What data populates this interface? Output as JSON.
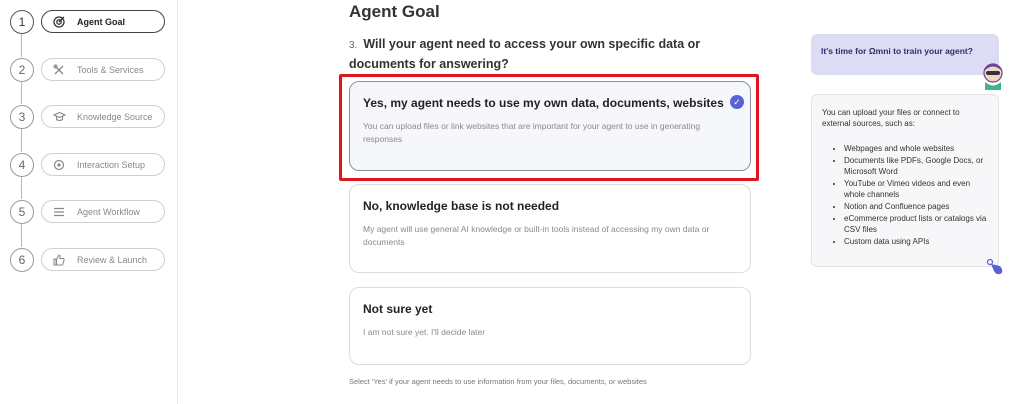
{
  "steps": [
    {
      "num": "1",
      "label": "Agent Goal",
      "icon": "target-icon",
      "active": true
    },
    {
      "num": "2",
      "label": "Tools & Services",
      "icon": "tools-icon",
      "active": false
    },
    {
      "num": "3",
      "label": "Knowledge Source",
      "icon": "graduation-cap-icon",
      "active": false
    },
    {
      "num": "4",
      "label": "Interaction Setup",
      "icon": "gear-icon",
      "active": false
    },
    {
      "num": "5",
      "label": "Agent Workflow",
      "icon": "list-icon",
      "active": false
    },
    {
      "num": "6",
      "label": "Review & Launch",
      "icon": "thumbs-up-icon",
      "active": false
    }
  ],
  "main": {
    "title": "Agent Goal",
    "question_number": "3.",
    "question": "Will your agent need to access your own specific data or documents for answering?",
    "options": [
      {
        "title": "Yes, my agent needs to use my own data, documents, websites",
        "description": "You can upload files or link websites that are important for your agent to use in generating responses",
        "selected": true
      },
      {
        "title": "No, knowledge base is not needed",
        "description": "My agent will use general AI knowledge or built-in tools instead of accessing my own data or documents",
        "selected": false
      },
      {
        "title": "Not sure yet",
        "description": "I am not sure yet. I'll decide later",
        "selected": false
      }
    ],
    "footnote": "Select 'Yes' if your agent needs to use information from your files, documents, or websites"
  },
  "helper": {
    "bubble": "It's time for Ωmni to train your agent?",
    "intro": "You can upload your files or connect to external sources, such as:",
    "items": [
      "Webpages and whole websites",
      "Documents like PDFs, Google Docs, or Microsoft Word",
      "YouTube or Vimeo videos and even whole channels",
      "Notion and Confluence pages",
      "eCommerce product lists or catalogs via CSV files",
      "Custom data using APIs"
    ]
  },
  "colors": {
    "accent": "#5a62d6",
    "highlight_border": "#e0161e",
    "bubble_bg": "#dcdcf5"
  }
}
